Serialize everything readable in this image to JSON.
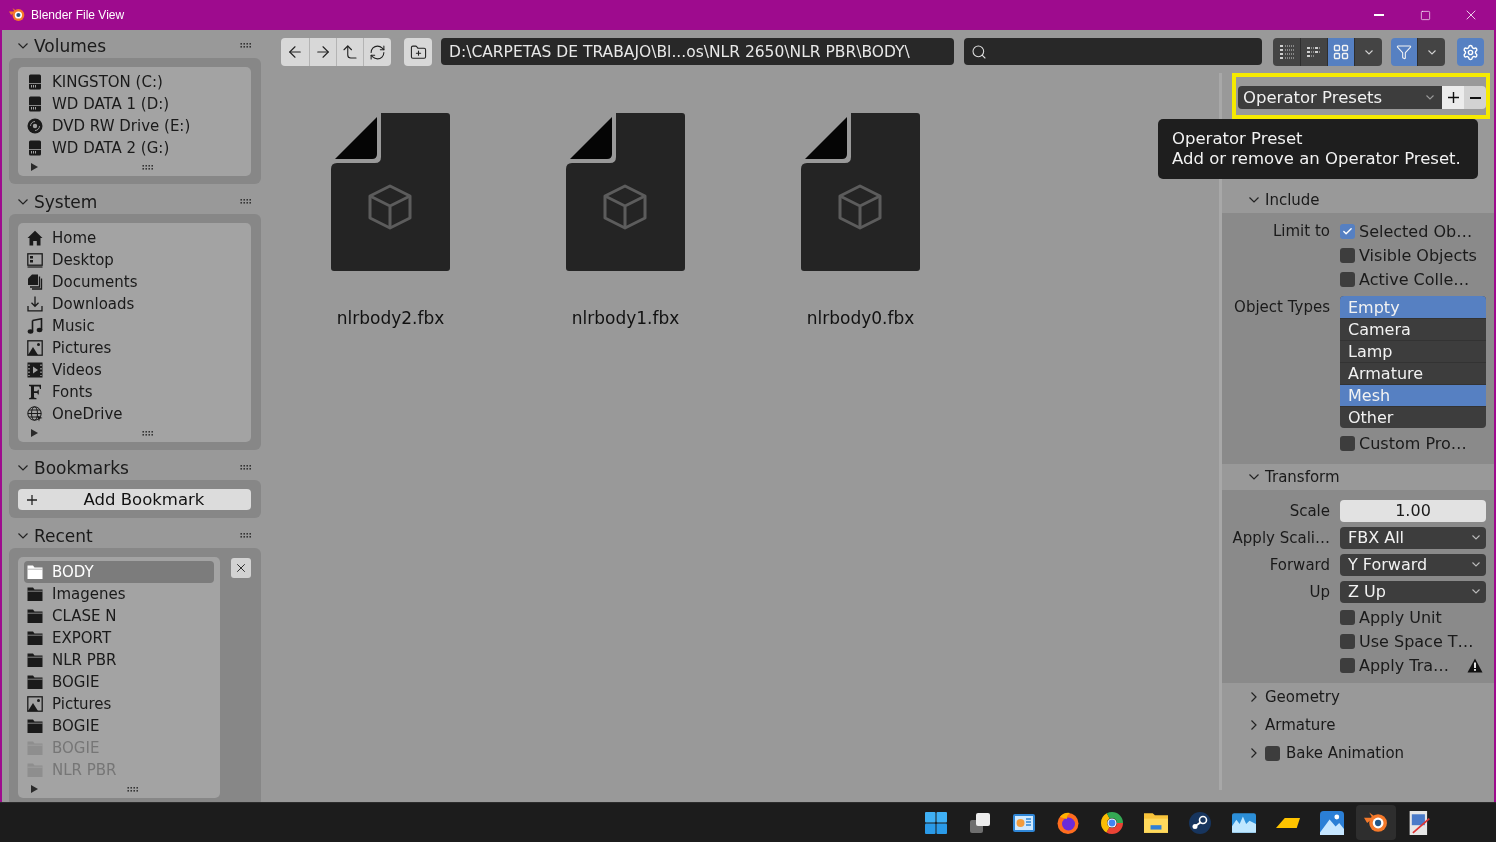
{
  "window": {
    "title": "Blender File View"
  },
  "sidebar": {
    "panels": [
      {
        "kind": "list",
        "title": "Volumes",
        "expanded": true,
        "items": [
          {
            "kind": "drive",
            "label": "KINGSTON (C:)"
          },
          {
            "kind": "drive",
            "label": "WD DATA 1 (D:)"
          },
          {
            "kind": "disc",
            "label": "DVD RW Drive (E:)"
          },
          {
            "kind": "drive",
            "label": "WD DATA 2 (G:)"
          }
        ]
      },
      {
        "kind": "list",
        "title": "System",
        "expanded": true,
        "items": [
          {
            "kind": "home",
            "label": "Home"
          },
          {
            "kind": "desktop",
            "label": "Desktop"
          },
          {
            "kind": "documents",
            "label": "Documents"
          },
          {
            "kind": "downloads",
            "label": "Downloads"
          },
          {
            "kind": "music",
            "label": "Music"
          },
          {
            "kind": "pictures",
            "label": "Pictures"
          },
          {
            "kind": "videos",
            "label": "Videos"
          },
          {
            "kind": "fonts",
            "label": "Fonts"
          },
          {
            "kind": "globe",
            "label": "OneDrive"
          }
        ]
      },
      {
        "kind": "bookmarks",
        "title": "Bookmarks",
        "expanded": true,
        "button": "Add Bookmark"
      },
      {
        "kind": "recent",
        "title": "Recent",
        "expanded": true,
        "items": [
          {
            "kind": "folder",
            "label": "BODY",
            "selected": true,
            "disabled": false
          },
          {
            "kind": "folder",
            "label": "Imagenes",
            "selected": false,
            "disabled": false
          },
          {
            "kind": "folder",
            "label": "CLASE N",
            "selected": false,
            "disabled": false
          },
          {
            "kind": "folder",
            "label": "EXPORT",
            "selected": false,
            "disabled": false
          },
          {
            "kind": "folder",
            "label": "NLR PBR",
            "selected": false,
            "disabled": false
          },
          {
            "kind": "folder",
            "label": "BOGIE",
            "selected": false,
            "disabled": false
          },
          {
            "kind": "pictures",
            "label": "Pictures",
            "selected": false,
            "disabled": false
          },
          {
            "kind": "folder",
            "label": "BOGIE",
            "selected": false,
            "disabled": false
          },
          {
            "kind": "folder",
            "label": "BOGIE",
            "selected": false,
            "disabled": true
          },
          {
            "kind": "folder",
            "label": "NLR PBR",
            "selected": false,
            "disabled": true
          }
        ]
      }
    ]
  },
  "toolbar": {
    "path": "D:\\CARPETAS DE TRABAJO\\Bl...os\\NLR 2650\\NLR PBR\\BODY\\",
    "display_modes": [
      {
        "kind": "vertical-list",
        "selected": false
      },
      {
        "kind": "horizontal-list",
        "selected": false
      },
      {
        "kind": "thumbnails",
        "selected": true
      }
    ],
    "filter": {
      "on": true
    },
    "settings": {
      "on": true
    }
  },
  "files": [
    {
      "name": "nlrbody2.fbx"
    },
    {
      "name": "nlrbody1.fbx"
    },
    {
      "name": "nlrbody0.fbx"
    }
  ],
  "properties": {
    "presets": {
      "value": "Operator Presets"
    },
    "tooltip": {
      "title": "Operator Preset",
      "description": "Add or remove an Operator Preset."
    },
    "sections": [
      {
        "title": "Include",
        "expanded": true,
        "rows": [
          {
            "kind": "checkbox",
            "label": "Limit to",
            "text": "Selected Ob…",
            "checked": true
          },
          {
            "kind": "checkbox",
            "text": "Visible Objects",
            "checked": false
          },
          {
            "kind": "checkbox",
            "text": "Active Colle…",
            "checked": false
          },
          {
            "kind": "options",
            "label": "Object Types",
            "options": [
              {
                "text": "Empty",
                "selected": true
              },
              {
                "text": "Camera",
                "selected": false
              },
              {
                "text": "Lamp",
                "selected": false
              },
              {
                "text": "Armature",
                "selected": false
              },
              {
                "text": "Mesh",
                "selected": true
              },
              {
                "text": "Other",
                "selected": false
              }
            ]
          },
          {
            "kind": "checkbox",
            "text": "Custom Pro…",
            "checked": false
          }
        ]
      },
      {
        "title": "Transform",
        "expanded": true,
        "rows": [
          {
            "kind": "number",
            "label": "Scale",
            "value": "1.00"
          },
          {
            "kind": "dropdown",
            "label": "Apply Scali…",
            "value": "FBX All"
          },
          {
            "kind": "dropdown",
            "label": "Forward",
            "value": "Y Forward"
          },
          {
            "kind": "dropdown",
            "label": "Up",
            "value": "Z Up"
          },
          {
            "kind": "checkbox",
            "text": "Apply Unit",
            "checked": false
          },
          {
            "kind": "checkbox",
            "text": "Use Space T…",
            "checked": false
          },
          {
            "kind": "checkbox",
            "text": "Apply Tra…",
            "checked": false,
            "warning": true
          }
        ]
      },
      {
        "title": "Geometry",
        "expanded": false
      },
      {
        "title": "Armature",
        "expanded": false
      },
      {
        "title": "Bake Animation",
        "expanded": false,
        "checked": false
      }
    ]
  },
  "taskbar": {
    "apps": [
      {
        "kind": "tiles",
        "active": false
      },
      {
        "kind": "windows",
        "active": false
      },
      {
        "kind": "chart-board",
        "active": false
      },
      {
        "kind": "flame-globe",
        "active": false
      },
      {
        "kind": "color-ring",
        "active": false
      },
      {
        "kind": "folder",
        "active": false
      },
      {
        "kind": "round-emblem",
        "active": false
      },
      {
        "kind": "wave-chart",
        "active": false
      },
      {
        "kind": "wedge",
        "active": false
      },
      {
        "kind": "mountain",
        "active": false
      },
      {
        "kind": "orbit-eye",
        "active": true
      },
      {
        "kind": "picture-pen",
        "active": false
      }
    ]
  }
}
